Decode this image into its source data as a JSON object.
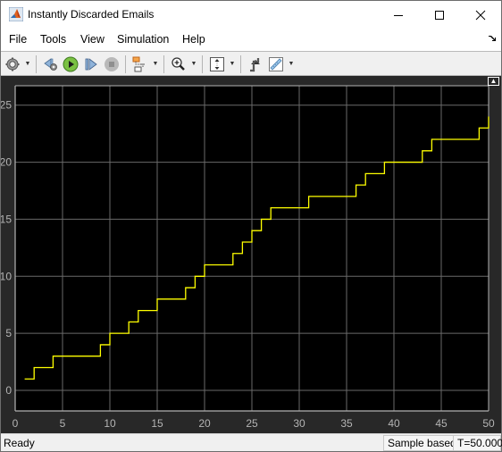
{
  "window": {
    "title": "Instantly Discarded Emails",
    "controls": {
      "minimize": "minimize",
      "maximize": "maximize",
      "close": "close"
    }
  },
  "menu": {
    "items": [
      {
        "label": "File"
      },
      {
        "label": "Tools"
      },
      {
        "label": "View"
      },
      {
        "label": "Simulation"
      },
      {
        "label": "Help"
      }
    ],
    "undock_icon": "undock-arrow-icon"
  },
  "toolbar": {
    "items": [
      {
        "icon": "gear-icon",
        "dropdown": true
      },
      {
        "icon": "step-back-icon",
        "dropdown": false
      },
      {
        "icon": "run-icon",
        "dropdown": false
      },
      {
        "icon": "step-forward-icon",
        "dropdown": false
      },
      {
        "icon": "stop-icon",
        "dropdown": false
      },
      {
        "icon": "highlight-signal-icon",
        "dropdown": true
      },
      {
        "icon": "zoom-in-icon",
        "dropdown": true
      },
      {
        "icon": "autoscale-icon",
        "dropdown": true
      },
      {
        "icon": "triggers-icon",
        "dropdown": false
      },
      {
        "icon": "measurements-ruler-icon",
        "dropdown": true
      }
    ]
  },
  "status": {
    "left": "Ready",
    "mode": "Sample based",
    "time": "T=50.000"
  },
  "colors": {
    "plot_background": "#000000",
    "scope_background": "#282828",
    "grid": "#6a6a6a",
    "axes": "#b4b4b4",
    "tick_text": "#b4b4b4",
    "signal": "#ffff00"
  },
  "chart_data": {
    "type": "line",
    "style": "stairs",
    "title": "",
    "xlabel": "",
    "ylabel": "",
    "xlim": [
      0,
      50
    ],
    "ylim": [
      -1.8,
      26.7
    ],
    "grid": true,
    "legend": "none",
    "xticks": [
      0,
      5,
      10,
      15,
      20,
      25,
      30,
      35,
      40,
      45,
      50
    ],
    "yticks": [
      0,
      5,
      10,
      15,
      20,
      25
    ],
    "series": [
      {
        "name": "Instantly Discarded Emails",
        "x": [
          1,
          2,
          4,
          9,
          10,
          12,
          13,
          15,
          18,
          19,
          20,
          23,
          24,
          25,
          26,
          27,
          31,
          36,
          37,
          39,
          43,
          44,
          49,
          50
        ],
        "y": [
          1,
          2,
          3,
          4,
          5,
          6,
          7,
          8,
          9,
          10,
          11,
          12,
          13,
          14,
          15,
          16,
          17,
          18,
          19,
          20,
          21,
          22,
          23,
          24
        ]
      }
    ]
  }
}
